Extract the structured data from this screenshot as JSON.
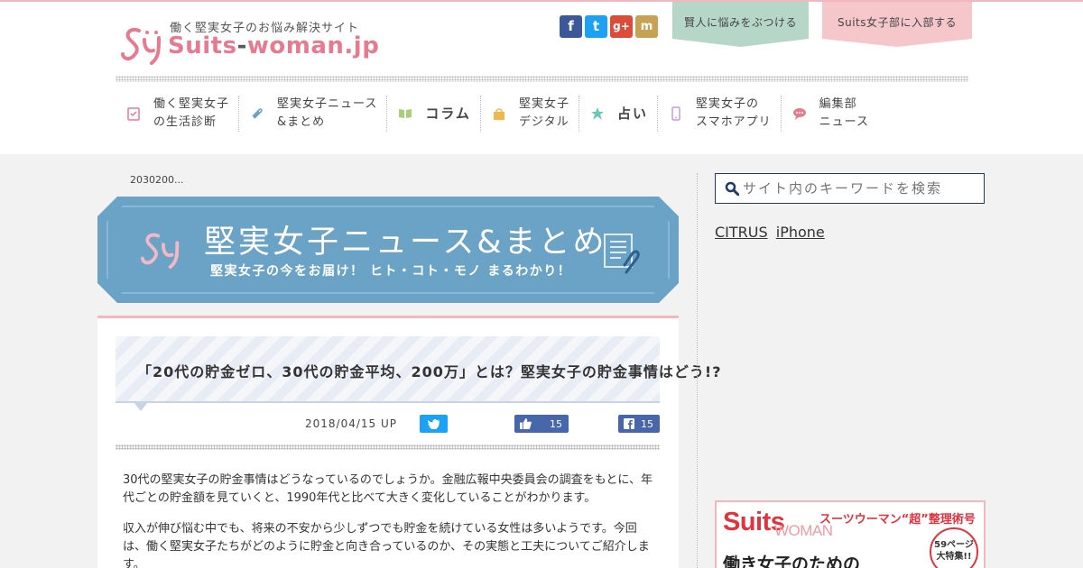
{
  "site": {
    "tagline": "働く堅実女子のお悩み解決サイト",
    "logo_main": "Suits",
    "logo_dash": "-",
    "logo_woman": "woman",
    "logo_dot": ".",
    "logo_jp": "jp"
  },
  "header": {
    "ribbon_consult": "賢人に悩みをぶつける",
    "ribbon_join": "Suits女子部に入部する"
  },
  "social": {
    "facebook": "f",
    "twitter": "t",
    "googleplus": "g+",
    "mixi": "m"
  },
  "nav": {
    "items": [
      {
        "label": "働く堅実女子\nの生活診断",
        "icon": "clipboard-check-icon",
        "color": "#e87a90"
      },
      {
        "label": "堅実女子ニュース\n&まとめ",
        "icon": "paperclip-icon",
        "color": "#6aa3c6"
      },
      {
        "label": "コラム",
        "icon": "open-book-icon",
        "color": "#a9cf7a"
      },
      {
        "label": "堅実女子\nデジタル",
        "icon": "shopping-bag-icon",
        "color": "#f0b84a"
      },
      {
        "label": "占い",
        "icon": "star-icon",
        "color": "#6cc7b6"
      },
      {
        "label": "堅実女子の\nスマホアプリ",
        "icon": "smartphone-icon",
        "color": "#c89ad8"
      },
      {
        "label": "編集部\nニュース",
        "icon": "speech-bubble-icon",
        "color": "#e87a90"
      }
    ]
  },
  "breadcrumb": "2030200...",
  "banner": {
    "title": "堅実女子ニュース&まとめ",
    "subtitle": "堅実女子の今をお届け！ ヒト・コト・モノ まるわかり！"
  },
  "article": {
    "title": "「20代の貯金ゼロ、30代の貯金平均、200万」とは？堅実女子の貯金事情はどう!?",
    "date": "2018/04/15 UP",
    "like_count": "15",
    "share_count": "15",
    "paragraphs": [
      "30代の堅実女子の貯金事情はどうなっているのでしょうか。金融広報中央委員会の調査をもとに、年代ごとの貯金額を見ていくと、1990年代と比べて大きく変化していることがわかります。",
      "収入が伸び悩む中でも、将来の不安から少しずつでも貯金を続けている女性は多いようです。今回は、働く堅実女子たちがどのように貯金と向き合っているのか、その実態と工夫についてご紹介します。"
    ]
  },
  "sidebar": {
    "search_placeholder": "サイト内のキーワードを検索",
    "links": [
      "CITRUS",
      "iPhone"
    ]
  },
  "ad": {
    "brand": "Suits",
    "brand_sub": "WOMAN",
    "headline": "スーツウーマン“超”整理術号",
    "badge_line1": "59ページ",
    "badge_line2": "大特集!!",
    "text": "働き女子のための"
  },
  "colors": {
    "accent_pink": "#e87a90",
    "banner_blue": "#6aa3c6",
    "ribbon_green": "#b6d6c8",
    "ribbon_pink": "#f5c7cb"
  }
}
